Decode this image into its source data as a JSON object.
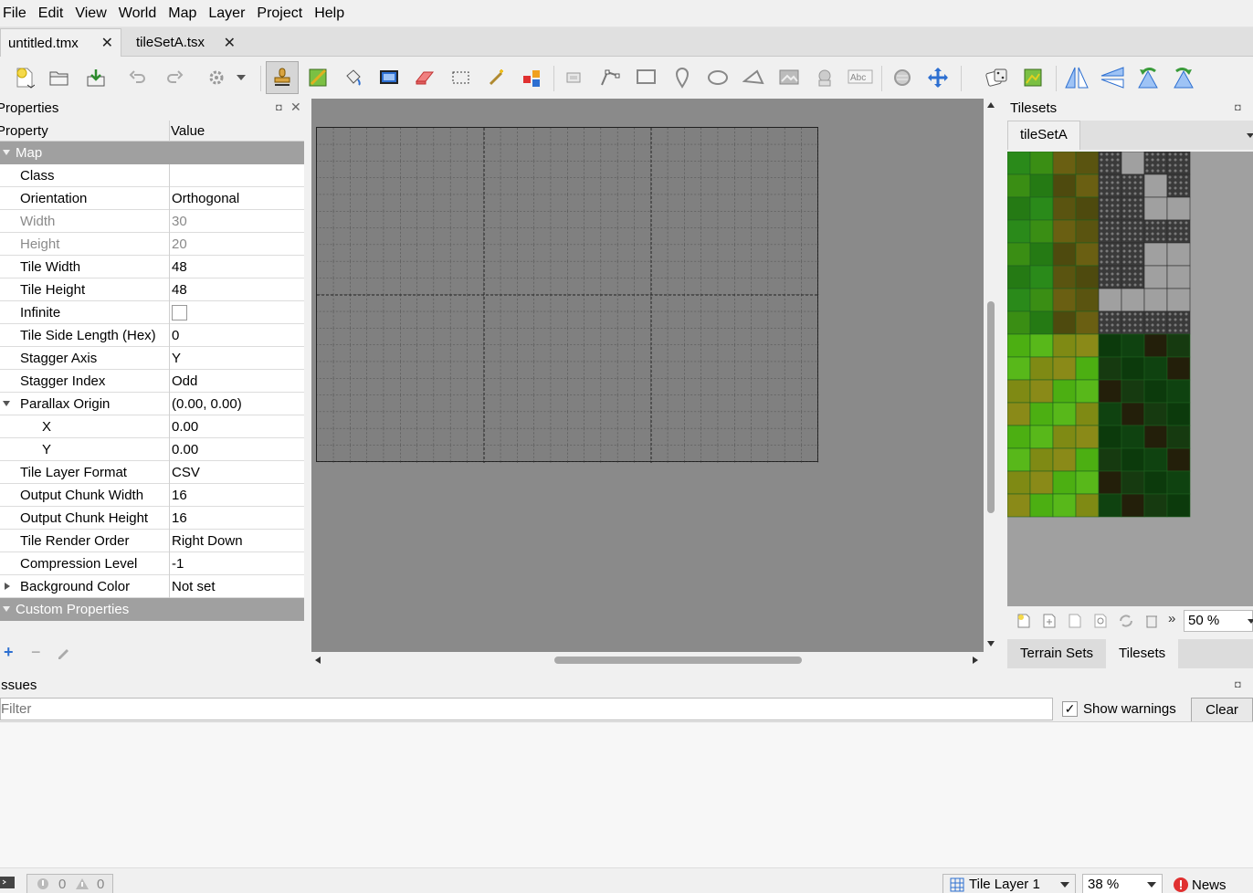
{
  "menu": [
    "File",
    "Edit",
    "View",
    "World",
    "Map",
    "Layer",
    "Project",
    "Help"
  ],
  "tabs": [
    {
      "label": "untitled.tmx",
      "active": true
    },
    {
      "label": "tileSetA.tsx",
      "active": false
    }
  ],
  "properties": {
    "title": "Properties",
    "header": {
      "property": "Property",
      "value": "Value"
    },
    "rows": [
      {
        "name": "Map",
        "value": "",
        "kind": "group"
      },
      {
        "name": "Class",
        "value": ""
      },
      {
        "name": "Orientation",
        "value": "Orthogonal"
      },
      {
        "name": "Width",
        "value": "30",
        "kind": "readonly"
      },
      {
        "name": "Height",
        "value": "20",
        "kind": "readonly"
      },
      {
        "name": "Tile Width",
        "value": "48"
      },
      {
        "name": "Tile Height",
        "value": "48"
      },
      {
        "name": "Infinite",
        "value": "",
        "kind": "checkbox"
      },
      {
        "name": "Tile Side Length (Hex)",
        "value": "0"
      },
      {
        "name": "Stagger Axis",
        "value": "Y"
      },
      {
        "name": "Stagger Index",
        "value": "Odd"
      },
      {
        "name": "Parallax Origin",
        "value": "(0.00, 0.00)",
        "kind": "expanded"
      },
      {
        "name": "X",
        "value": "0.00",
        "kind": "indent"
      },
      {
        "name": "Y",
        "value": "0.00",
        "kind": "indent"
      },
      {
        "name": "Tile Layer Format",
        "value": "CSV"
      },
      {
        "name": "Output Chunk Width",
        "value": "16"
      },
      {
        "name": "Output Chunk Height",
        "value": "16"
      },
      {
        "name": "Tile Render Order",
        "value": "Right Down"
      },
      {
        "name": "Compression Level",
        "value": "-1"
      },
      {
        "name": "Background Color",
        "value": "Not set",
        "kind": "collapsed"
      },
      {
        "name": "Custom Properties",
        "value": "",
        "kind": "group"
      }
    ]
  },
  "tilesets": {
    "title": "Tilesets",
    "active_tab": "tileSetA",
    "zoom": "50 %",
    "bottom_tabs": [
      "Terrain Sets",
      "Tilesets"
    ]
  },
  "issues": {
    "title": "Issues",
    "filter_placeholder": "Filter",
    "show_warnings_label": "Show warnings",
    "show_warnings_checked": true,
    "check_mark": "✓",
    "clear_label": "Clear"
  },
  "status": {
    "errors": "0",
    "warnings": "0",
    "layer": "Tile Layer 1",
    "zoom": "38 %",
    "news": "News"
  },
  "colors": {
    "accent_blue": "#2d6fd1",
    "group_row_bg": "#a0a0a0",
    "map_bg": "#8a8a8a",
    "news_red": "#e03030"
  }
}
